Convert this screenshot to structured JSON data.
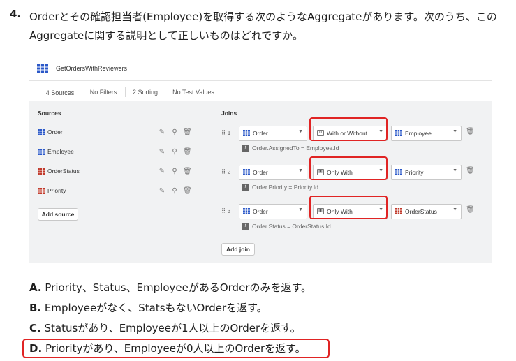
{
  "question": {
    "number": "4.",
    "text": "Orderとその確認担当者(Employee)を取得する次のようなAggregateがあります。次のうち、このAggregateに関する説明として正しいものはどれですか。"
  },
  "aggregate": {
    "title": "GetOrdersWithReviewers",
    "tabs": [
      "4 Sources",
      "No Filters",
      "2 Sorting",
      "No Test Values"
    ],
    "sources_title": "Sources",
    "sources": [
      "Order",
      "Employee",
      "OrderStatus",
      "Priority"
    ],
    "add_source_label": "Add source",
    "joins_title": "Joins",
    "joins": [
      {
        "num": "1",
        "left": "Order",
        "type": "With or Without",
        "right": "Employee",
        "condition": "Order.AssignedTo = Employee.Id"
      },
      {
        "num": "2",
        "left": "Order",
        "type": "Only With",
        "right": "Priority",
        "condition": "Order.Priority = Priority.Id"
      },
      {
        "num": "3",
        "left": "Order",
        "type": "Only With",
        "right": "OrderStatus",
        "condition": "Order.Status = OrderStatus.Id"
      }
    ],
    "add_join_label": "Add join",
    "entity_icon_color": "#2b58c8",
    "highlight_color": "#e02424"
  },
  "answers": [
    {
      "letter": "A.",
      "text": "Priority、Status、EmployeeがあるOrderのみを返す。"
    },
    {
      "letter": "B.",
      "text": "Employeeがなく、StatsもないOrderを返す。"
    },
    {
      "letter": "C.",
      "text": "Statusがあり、Employeeが1人以上のOrderを返す。"
    },
    {
      "letter": "D.",
      "text": "Priorityがあり、Employeeが0人以上のOrderを返す。"
    }
  ]
}
